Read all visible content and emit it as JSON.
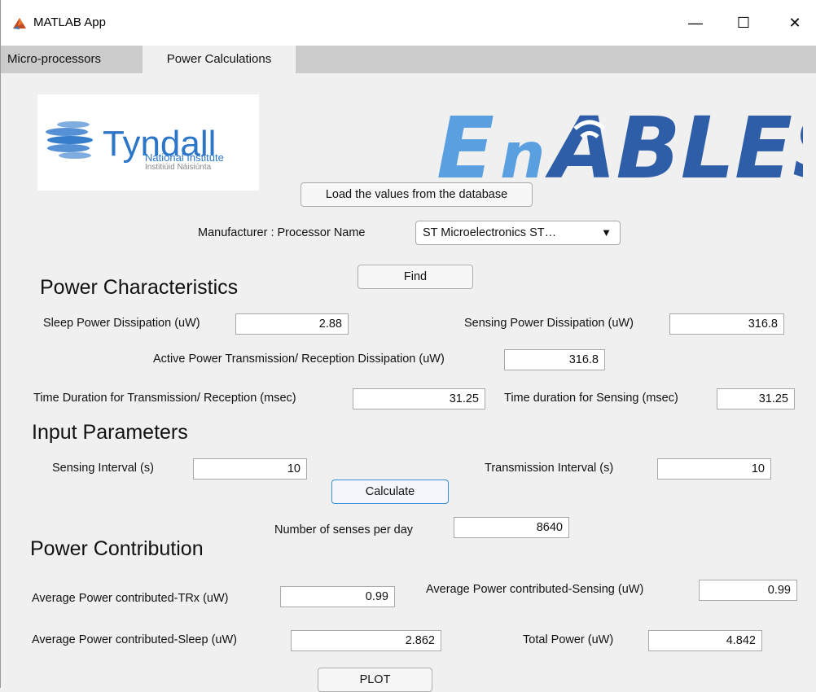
{
  "window": {
    "title": "MATLAB App",
    "minimize": "—",
    "maximize": "☐",
    "close": "✕"
  },
  "tabs": [
    {
      "label": "Micro-processors"
    },
    {
      "label": "Power Calculations"
    }
  ],
  "logos": {
    "tyndall": {
      "name": "Tyndall",
      "line1": "National Institute",
      "line2": "Institiúid Náisiúnta"
    },
    "enables": {
      "text": "EnABLES"
    }
  },
  "load_button": "Load the values from the database",
  "manufacturer": {
    "label": "Manufacturer : Processor Name",
    "selected": "ST Microelectronics ST…",
    "arrow": "▼"
  },
  "find_button": "Find",
  "power_characteristics": {
    "heading": "Power Characteristics",
    "sleep_label": "Sleep Power Dissipation (uW)",
    "sleep_value": "2.88",
    "sensing_label": "Sensing Power Dissipation (uW)",
    "sensing_value": "316.8",
    "active_label": "Active Power Transmission/ Reception Dissipation (uW)",
    "active_value": "316.8",
    "trx_time_label": "Time Duration for Transmission/ Reception (msec)",
    "trx_time_value": "31.25",
    "sense_time_label": "Time duration for Sensing (msec)",
    "sense_time_value": "31.25"
  },
  "input_parameters": {
    "heading": "Input Parameters",
    "sensing_interval_label": "Sensing Interval  (s)",
    "sensing_interval_value": "10",
    "transmission_interval_label": "Transmission Interval  (s)",
    "transmission_interval_value": "10",
    "calculate_button": "Calculate",
    "senses_label": "Number of senses per day",
    "senses_value": "8640"
  },
  "power_contribution": {
    "heading": "Power Contribution",
    "trx_label": "Average Power contributed-TRx (uW)",
    "trx_value": "0.99",
    "sensing_label": "Average Power contributed-Sensing (uW)",
    "sensing_value": "0.99",
    "sleep_label": "Average Power contributed-Sleep (uW)",
    "sleep_value": "2.862",
    "total_label": "Total Power (uW)",
    "total_value": "4.842"
  },
  "plot_button": "PLOT",
  "colors": {
    "tyndall_blue": "#2b76c9",
    "enables_blue": "#2f5ea8",
    "enables_light": "#5aa0e0",
    "tabbar": "#cbcbcb",
    "calc_border": "#3a8fd6"
  }
}
